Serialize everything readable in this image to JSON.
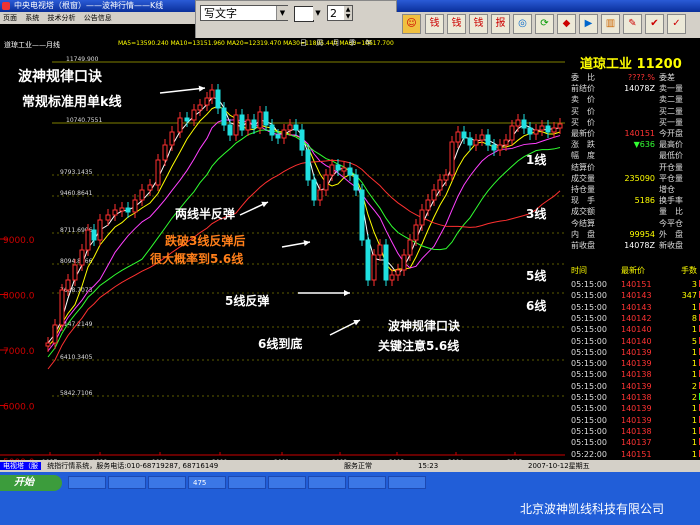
{
  "window": {
    "title": "中央电视塔（根窗）——波神行情——K线"
  },
  "menubar": [
    "页面",
    "系统",
    "技术分析",
    "公告信息"
  ],
  "drawing_toolbar": {
    "font": "写文字",
    "size": "2"
  },
  "toolbar": {
    "icons": [
      "钱",
      "钱",
      "钱",
      "报"
    ]
  },
  "chart_header": {
    "title": "道琼工业——月线",
    "ma_info": "MA5=13590.240  MA10=13151.960 MA20=12319.470 MA30=11805.440 MA60=10617.700",
    "periods": [
      "日",
      "周",
      "月",
      "季",
      "年"
    ]
  },
  "chart_data": {
    "type": "candlestick",
    "x_labels": [
      "1997",
      "1998",
      "1999",
      "2000",
      "2001",
      "2002",
      "2003",
      "2004",
      "2005"
    ],
    "y_ticks": [
      5000,
      6000,
      7000,
      8000,
      9000
    ],
    "price_levels": [
      "11749.900",
      "10740.7551",
      "9793.1435",
      "9460.8641",
      "8711.6906",
      "8094.8266",
      "7688.7073",
      "7147.2149",
      "6410.3405",
      "5842.7106"
    ],
    "annotations": [
      {
        "text": "波神规律口诀",
        "color": "#ffffff"
      },
      {
        "text": "常规标准用单k线",
        "color": "#ffffff"
      },
      {
        "text": "两线半反弹",
        "color": "#ffffff"
      },
      {
        "text": "跌破3线反弹后",
        "color": "#ff7f1a"
      },
      {
        "text": "很大概率到5.6线",
        "color": "#ff7f1a"
      },
      {
        "text": "5线反弹",
        "color": "#ffffff"
      },
      {
        "text": "6线到底",
        "color": "#ffffff"
      },
      {
        "text": "波神规律口诀",
        "color": "#ffffff"
      },
      {
        "text": "关键注意5.6线",
        "color": "#ffffff"
      }
    ],
    "line_labels": [
      "1线",
      "3线",
      "5线",
      "6线"
    ]
  },
  "quote_panel": {
    "name": "道琼工业",
    "price_head": "11200",
    "rows": [
      {
        "label": "委　比",
        "value": "????.%",
        "label2": "委差",
        "color": "#ff3333"
      },
      {
        "label": "前结价",
        "value": "14078Z",
        "label2": "卖一量",
        "color": "#ffffff"
      },
      {
        "label": "卖　价",
        "value": "",
        "label2": "卖二量",
        "color": "#ffffff"
      },
      {
        "label": "买　价",
        "value": "",
        "label2": "买二量",
        "color": "#ffffff"
      },
      {
        "label": "买　价",
        "value": "",
        "label2": "买一量",
        "color": "#ffffff"
      },
      {
        "label": "最新价",
        "value": "140151",
        "label2": "今开盘",
        "color": "#ff3333"
      },
      {
        "label": "涨　跌",
        "value": "▼636",
        "label2": "最高价",
        "color": "#33ff33"
      },
      {
        "label": "幅　度",
        "value": "",
        "label2": "最低价",
        "color": "#ffffff"
      },
      {
        "label": "结算价",
        "value": "",
        "label2": "开仓量",
        "color": "#ffffff"
      },
      {
        "label": "成交量",
        "value": "235090",
        "label2": "平仓量",
        "color": "#ffff00"
      },
      {
        "label": "持仓量",
        "value": "",
        "label2": "增仓",
        "color": "#ffffff"
      },
      {
        "label": "现　手",
        "value": "5186",
        "label2": "换手率",
        "color": "#ffff00"
      },
      {
        "label": "成交额",
        "value": "",
        "label2": "量　比",
        "color": "#ffffff"
      },
      {
        "label": "今结算",
        "value": "",
        "label2": "今平仓",
        "color": "#ffffff"
      },
      {
        "label": "内　盘",
        "value": "99954",
        "label2": "外　盘",
        "color": "#ffff00"
      },
      {
        "label": "前收盘",
        "value": "14078Z",
        "label2": "新收盘",
        "color": "#ffffff"
      }
    ],
    "tick_headers": [
      "时间",
      "最新价",
      "手数"
    ],
    "ticks": [
      {
        "time": "05:15:00",
        "price": "140151",
        "qty": "3",
        "dir": "up"
      },
      {
        "time": "05:15:00",
        "price": "140143",
        "qty": "347",
        "dir": "up"
      },
      {
        "time": "05:15:00",
        "price": "140143",
        "qty": "1",
        "dir": "up"
      },
      {
        "time": "05:15:00",
        "price": "140142",
        "qty": "8",
        "dir": "up"
      },
      {
        "time": "05:15:00",
        "price": "140140",
        "qty": "1",
        "dir": "up"
      },
      {
        "time": "05:15:00",
        "price": "140140",
        "qty": "5",
        "dir": "up"
      },
      {
        "time": "05:15:00",
        "price": "140139",
        "qty": "1",
        "dir": "up"
      },
      {
        "time": "05:15:00",
        "price": "140139",
        "qty": "1",
        "dir": "up"
      },
      {
        "time": "05:15:00",
        "price": "140138",
        "qty": "1",
        "dir": "up"
      },
      {
        "time": "05:15:00",
        "price": "140139",
        "qty": "2",
        "dir": "up"
      },
      {
        "time": "05:15:00",
        "price": "140138",
        "qty": "2",
        "dir": "down"
      },
      {
        "time": "05:15:00",
        "price": "140139",
        "qty": "1",
        "dir": "up"
      },
      {
        "time": "05:15:00",
        "price": "140139",
        "qty": "1",
        "dir": "up"
      },
      {
        "time": "05:15:00",
        "price": "140138",
        "qty": "1",
        "dir": "up"
      },
      {
        "time": "05:15:00",
        "price": "140137",
        "qty": "1",
        "dir": "up"
      },
      {
        "time": "05:22:00",
        "price": "140151",
        "qty": "1",
        "dir": "up"
      }
    ]
  },
  "statusbar": {
    "tabs": "电视塔（服",
    "text": "统指行情系统，服务电话:010-68719287, 68716149",
    "server": "服务正常",
    "time": "15:23",
    "date": "2007-10-12星期五"
  },
  "taskbar": {
    "start": "开始",
    "items": [
      "",
      "",
      "",
      "475",
      "",
      "",
      "",
      "",
      ""
    ],
    "watermark": "北京波神凯线科技有限公司"
  }
}
